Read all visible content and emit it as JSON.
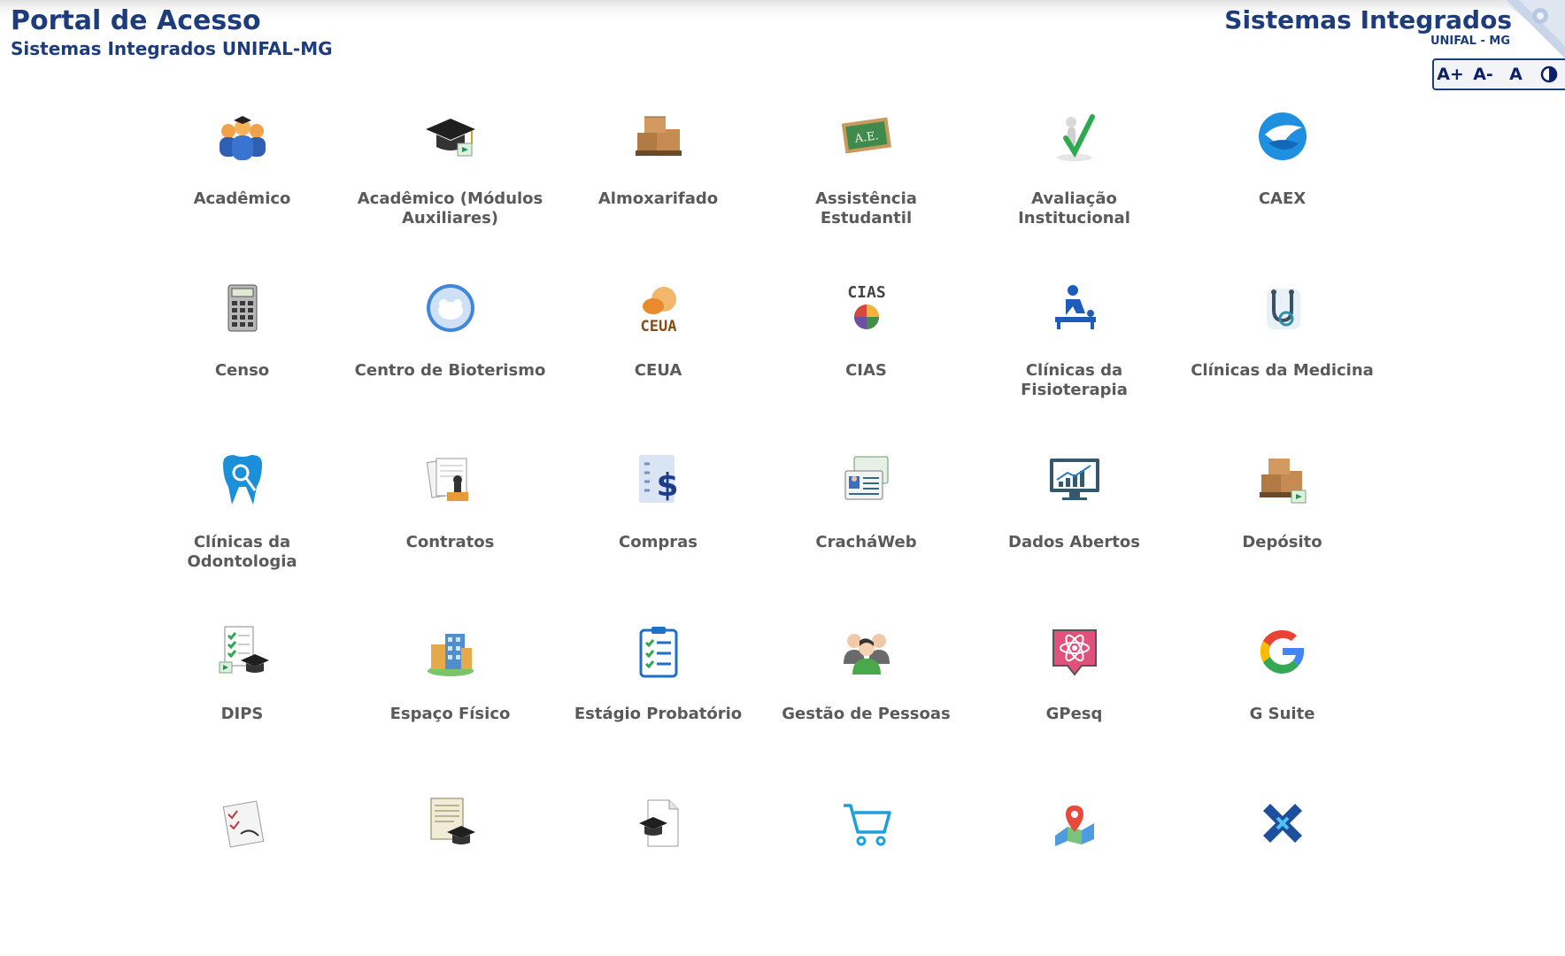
{
  "header": {
    "title": "Portal de Acesso",
    "subtitle": "Sistemas Integrados UNIFAL-MG",
    "brand_title": "Sistemas Integrados",
    "brand_subtitle": "UNIFAL - MG"
  },
  "accessibility": {
    "increase": "A+",
    "decrease": "A-",
    "reset": "A",
    "contrast_icon": "contrast-icon"
  },
  "colors": {
    "header_text": "#1d3c7c",
    "label_text": "#5a5a5a"
  },
  "systems": [
    {
      "label": "Acadêmico",
      "icon": "academic-users-icon"
    },
    {
      "label": "Acadêmico (Módulos Auxiliares)",
      "icon": "graduation-cap-icon"
    },
    {
      "label": "Almoxarifado",
      "icon": "boxes-pallet-icon"
    },
    {
      "label": "Assistência Estudantil",
      "icon": "chalkboard-icon"
    },
    {
      "label": "Avaliação Institucional",
      "icon": "checkmark-person-icon"
    },
    {
      "label": "CAEX",
      "icon": "caex-logo-icon"
    },
    {
      "label": "Censo",
      "icon": "calculator-icon"
    },
    {
      "label": "Centro de Bioterismo",
      "icon": "mouse-badge-icon"
    },
    {
      "label": "CEUA",
      "icon": "ceua-logo-icon"
    },
    {
      "label": "CIAS",
      "icon": "cias-logo-icon"
    },
    {
      "label": "Clínicas da Fisioterapia",
      "icon": "physiotherapy-icon"
    },
    {
      "label": "Clínicas da Medicina",
      "icon": "stethoscope-icon"
    },
    {
      "label": "Clínicas da Odontologia",
      "icon": "tooth-icon"
    },
    {
      "label": "Contratos",
      "icon": "contract-stamp-icon"
    },
    {
      "label": "Compras",
      "icon": "purchase-list-icon"
    },
    {
      "label": "CracháWeb",
      "icon": "badge-card-icon"
    },
    {
      "label": "Dados Abertos",
      "icon": "monitor-chart-icon"
    },
    {
      "label": "Depósito",
      "icon": "deposit-boxes-icon"
    },
    {
      "label": "DIPS",
      "icon": "checklist-cap-icon"
    },
    {
      "label": "Espaço Físico",
      "icon": "building-icon"
    },
    {
      "label": "Estágio Probatório",
      "icon": "clipboard-check-icon"
    },
    {
      "label": "Gestão de Pessoas",
      "icon": "people-group-icon"
    },
    {
      "label": "GPesq",
      "icon": "atom-badge-icon"
    },
    {
      "label": "G Suite",
      "icon": "google-icon"
    },
    {
      "label": "",
      "icon": "signed-document-icon"
    },
    {
      "label": "",
      "icon": "certificate-cap-icon"
    },
    {
      "label": "",
      "icon": "document-cap-icon"
    },
    {
      "label": "",
      "icon": "shopping-cart-icon"
    },
    {
      "label": "",
      "icon": "map-pin-icon"
    },
    {
      "label": "",
      "icon": "cross-logo-icon"
    }
  ]
}
